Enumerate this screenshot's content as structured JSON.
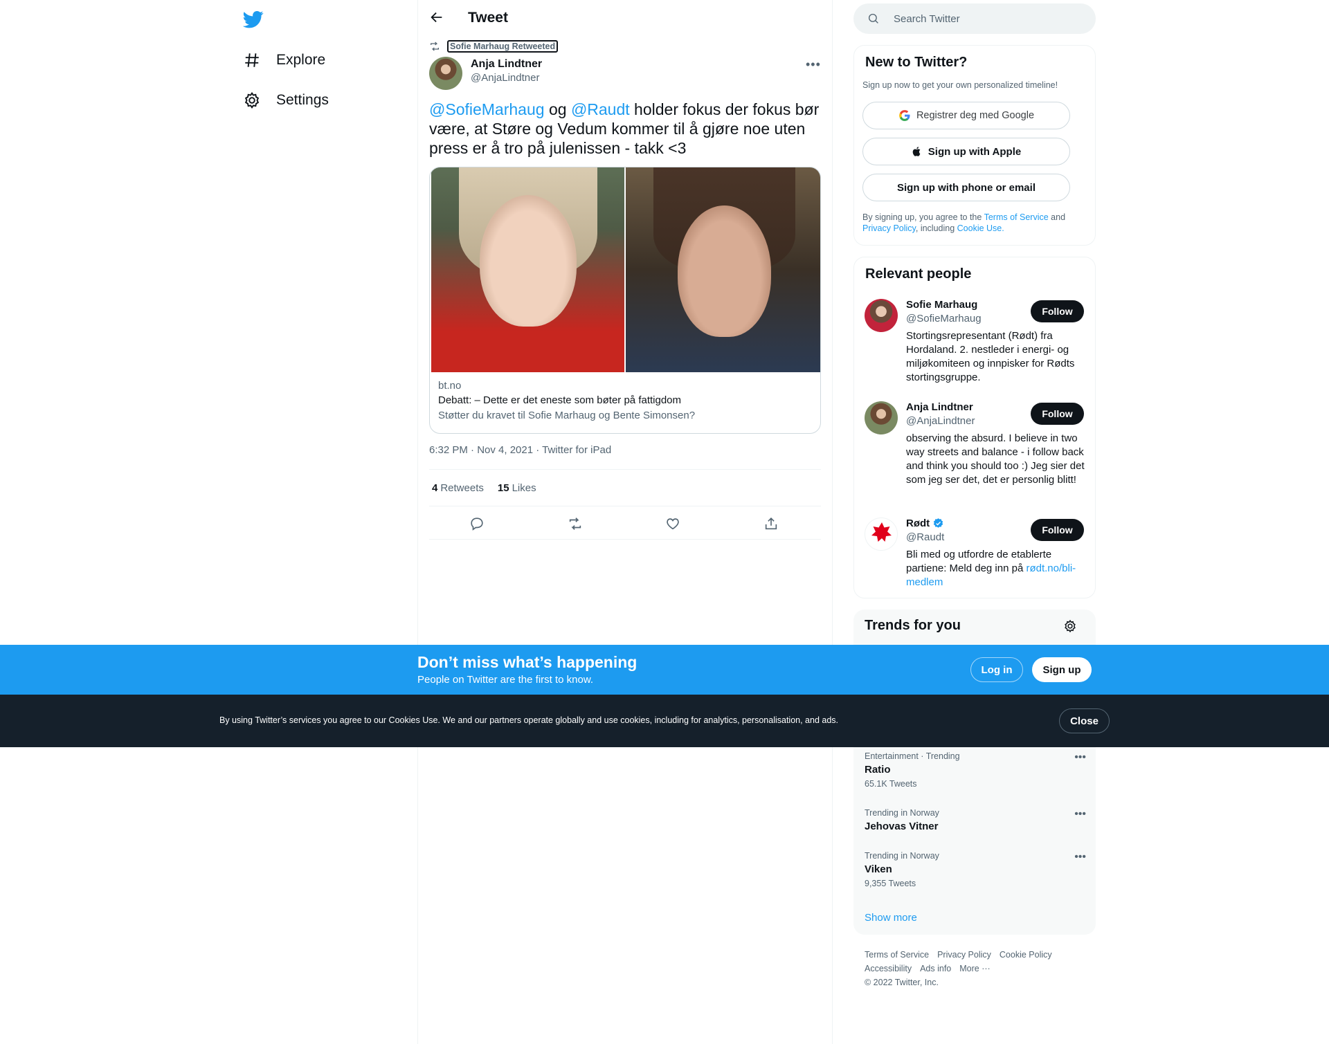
{
  "nav": {
    "items": [
      {
        "label": "Explore",
        "icon": "hashtag-icon"
      },
      {
        "label": "Settings",
        "icon": "gear-icon"
      }
    ]
  },
  "header": {
    "title": "Tweet"
  },
  "tweet": {
    "retweeted_by": "Sofie Marhaug Retweeted",
    "author_name": "Anja Lindtner",
    "author_handle": "@AnjaLindtner",
    "text_mention1": "@SofieMarhaug",
    "text_og": " og ",
    "text_mention2": "@Raudt",
    "text_rest": " holder fokus der fokus bør være, at Støre og Vedum kommer til å gjøre noe uten press er å tro på julenissen - takk <3",
    "card": {
      "domain": "bt.no",
      "title": "Debatt: – Dette er det eneste som bøter på fattigdom",
      "description": "Støtter du kravet til Sofie Marhaug og Bente Simonsen?"
    },
    "timestamp": "6:32 PM · Nov 4, 2021 · Twitter for iPad",
    "retweets_count": "4",
    "retweets_label": "Retweets",
    "likes_count": "15",
    "likes_label": "Likes"
  },
  "search": {
    "placeholder": "Search Twitter"
  },
  "new_to_twitter": {
    "title": "New to Twitter?",
    "subtitle": "Sign up now to get your own personalized timeline!",
    "google_btn": "Registrer deg med Google",
    "apple_btn": "Sign up with Apple",
    "phone_btn": "Sign up with phone or email",
    "legal_pre": "By signing up, you agree to the ",
    "terms": "Terms of Service",
    "and": " and ",
    "privacy": "Privacy Policy",
    "including": ", including ",
    "cookie": "Cookie Use."
  },
  "relevant_people": {
    "title": "Relevant people",
    "follow_label": "Follow",
    "people": [
      {
        "name": "Sofie Marhaug",
        "handle": "@SofieMarhaug",
        "bio": "Stortingsrepresentant (Rødt) fra Hordaland. 2. nestleder i energi- og miljøkomiteen og innpisker for Rødts stortingsgruppe."
      },
      {
        "name": "Anja Lindtner",
        "handle": "@AnjaLindtner",
        "bio": "observing the absurd. I believe in two way streets and balance - i follow back and think you should too :) Jeg sier det som jeg ser det, det er personlig blitt!"
      },
      {
        "name": "Rødt",
        "handle": "@Raudt",
        "bio": "Bli med og utfordre de etablerte partiene: Meld deg inn på ",
        "bio_link": "rødt.no/bli-medlem",
        "logo_text": "Rødt"
      }
    ]
  },
  "trends": {
    "title": "Trends for you",
    "items": [
      {
        "meta": "Entertainment · Trending",
        "name": "Ratio",
        "count": "65.1K Tweets"
      },
      {
        "meta": "Trending in Norway",
        "name": "Jehovas Vitner",
        "count": ""
      },
      {
        "meta": "Trending in Norway",
        "name": "Viken",
        "count": "9,355 Tweets"
      }
    ],
    "show_more": "Show more"
  },
  "footer": {
    "links": [
      "Terms of Service",
      "Privacy Policy",
      "Cookie Policy",
      "Accessibility",
      "Ads info",
      "More ···"
    ],
    "copyright": "© 2022 Twitter, Inc."
  },
  "banner": {
    "title": "Don’t miss what’s happening",
    "subtitle": "People on Twitter are the first to know.",
    "login": "Log in",
    "signup": "Sign up"
  },
  "cookie_bar": {
    "text": "By using Twitter’s services you agree to our Cookies Use. We and our partners operate globally and use cookies, including for analytics, personalisation, and ads.",
    "close": "Close"
  },
  "colors": {
    "accent": "#1d9bf0",
    "dark": "#0f1419",
    "muted": "#536471",
    "cookie_bg": "#15202b",
    "rodt_red": "#e0001b"
  }
}
